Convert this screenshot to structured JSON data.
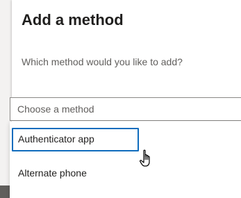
{
  "dialog": {
    "title": "Add a method",
    "question": "Which method would you like to add?"
  },
  "method_select": {
    "placeholder": "Choose a method",
    "options": [
      {
        "label": "Authenticator app",
        "focused": true
      },
      {
        "label": "Alternate phone",
        "focused": false
      }
    ]
  },
  "colors": {
    "focus": "#0f6cbd",
    "title": "#201f1e",
    "muted": "#605e5c"
  },
  "icons": {
    "cursor": "hand-pointer-icon"
  }
}
